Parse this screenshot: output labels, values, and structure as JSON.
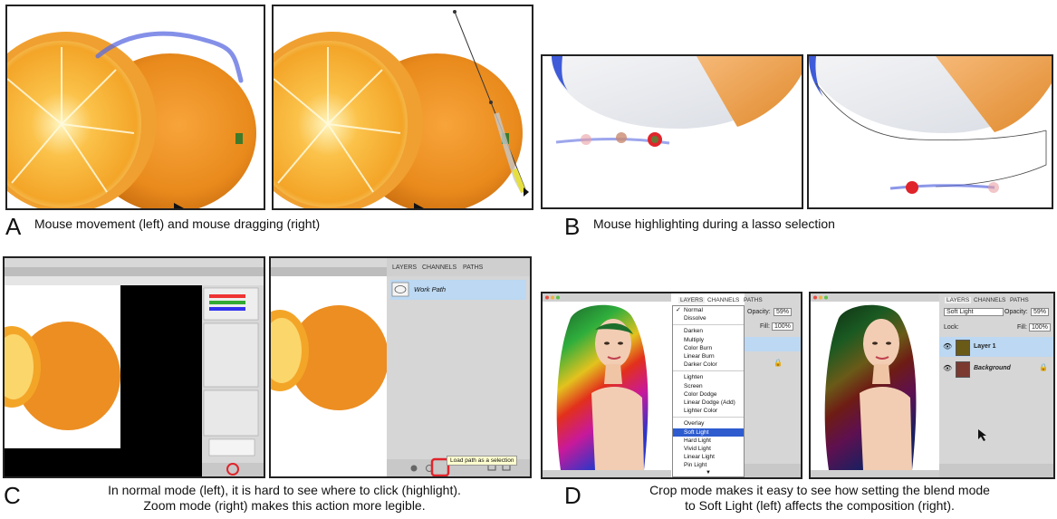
{
  "colors": {
    "accent_red": "#e0242b",
    "highlight_blue": "#bcd8f2",
    "stroke_blue": "#4a5fd6"
  },
  "panels": {
    "a": {
      "letter": "A",
      "caption": "Mouse movement (left) and mouse dragging (right)"
    },
    "b": {
      "letter": "B",
      "caption": "Mouse highlighting during a lasso selection"
    },
    "c": {
      "letter": "C",
      "caption_line1": "In normal mode (left), it is hard to see where to click (highlight).",
      "caption_line2": "Zoom mode (right) makes this action more legible.",
      "tabs": [
        "LAYERS",
        "CHANNELS",
        "PATHS"
      ],
      "path_name": "Work Path",
      "tooltip": "Load path as a selection"
    },
    "d": {
      "letter": "D",
      "caption_line1": "Crop mode makes it easy to see how setting the blend mode",
      "caption_line2": "to Soft Light (left) affects the composition (right).",
      "tabs": [
        "LAYERS",
        "CHANNELS",
        "PATHS"
      ],
      "blend_modes": [
        "Normal",
        "Dissolve",
        "Darken",
        "Multiply",
        "Color Burn",
        "Linear Burn",
        "Darker Color",
        "Lighten",
        "Screen",
        "Color Dodge",
        "Linear Dodge (Add)",
        "Lighter Color",
        "Overlay",
        "Soft Light",
        "Hard Light",
        "Vivid Light",
        "Linear Light",
        "Pin Light"
      ],
      "opacity_label": "Opacity:",
      "opacity_value": "59%",
      "fill_label": "Fill:",
      "fill_value": "100%",
      "blend_selected": "Soft Light",
      "lock_label": "Lock:",
      "layer1": "Layer 1",
      "background": "Background"
    }
  }
}
